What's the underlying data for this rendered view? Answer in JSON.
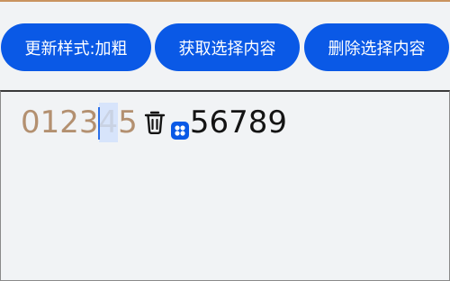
{
  "toolbar": {
    "buttons": [
      {
        "label": "更新样式:加粗"
      },
      {
        "label": "获取选择内容"
      },
      {
        "label": "删除选择内容"
      }
    ]
  },
  "editor": {
    "styled_text_before_caret": "0123",
    "selected_text": "4",
    "styled_text_after_selection": "5",
    "plain_text": "56789",
    "inline_icons": [
      "trash-icon",
      "app-grid-icon"
    ]
  },
  "colors": {
    "accent": "#0a59e6",
    "styled_text": "#b39070",
    "plain_text": "#141414",
    "background": "#f1f3f5",
    "caret": "#2a6ee8"
  }
}
